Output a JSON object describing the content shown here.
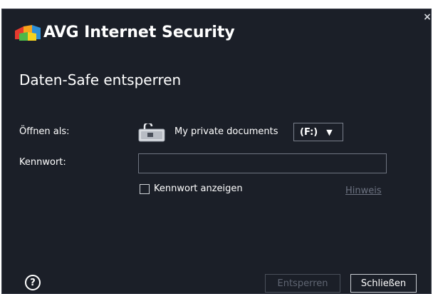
{
  "window": {
    "brand_avg": "AVG",
    "brand_product": "Internet Security",
    "close_glyph": "×"
  },
  "dialog": {
    "title": "Daten-Safe entsperren",
    "open_as_label": "Öffnen als:",
    "safe_name": "My private documents",
    "drive_value": "(F:)",
    "password_label": "Kennwort:",
    "password_value": "",
    "show_password_label": "Kennwort anzeigen",
    "show_password_checked": false,
    "hint_link": "Hinweis"
  },
  "footer": {
    "help_glyph": "?",
    "unlock_button": "Entsperren",
    "close_button": "Schließen"
  },
  "icons": {
    "logo": "avg-logo-icon",
    "safe": "safe-drive-icon",
    "dropdown": "dropdown-arrow-icon",
    "help": "help-icon",
    "close": "close-icon"
  },
  "colors": {
    "background": "#1b1f28",
    "text": "#ffffff",
    "disabled": "#5f6572",
    "link": "#6c7280"
  }
}
